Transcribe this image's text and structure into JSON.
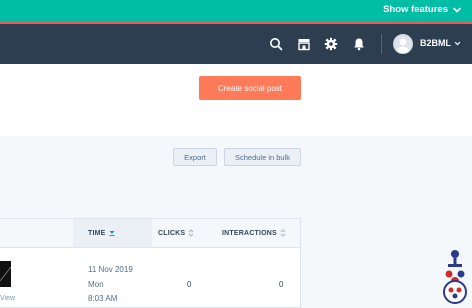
{
  "topbar": {
    "show_features": "Show features"
  },
  "nav": {
    "icons": [
      "search-icon",
      "marketplace-icon",
      "settings-icon",
      "notifications-icon"
    ],
    "account_name": "B2BML"
  },
  "actions": {
    "create_post": "Create social post",
    "export": "Export",
    "schedule_bulk": "Schedule in bulk"
  },
  "table": {
    "columns": [
      {
        "label": "TIME",
        "sorted": "desc"
      },
      {
        "label": "CLICKS",
        "sorted": null
      },
      {
        "label": "INTERACTIONS",
        "sorted": null
      }
    ],
    "rows": [
      {
        "view_label": "View",
        "date": "11 Nov 2019",
        "weekday": "Mon",
        "time": "8:03 AM",
        "clicks": "0",
        "interactions": "0"
      }
    ]
  },
  "colors": {
    "accent_teal": "#00bda5",
    "nav_dark": "#2d3e50",
    "primary_orange": "#ff7a59",
    "border": "#dfe3eb"
  }
}
